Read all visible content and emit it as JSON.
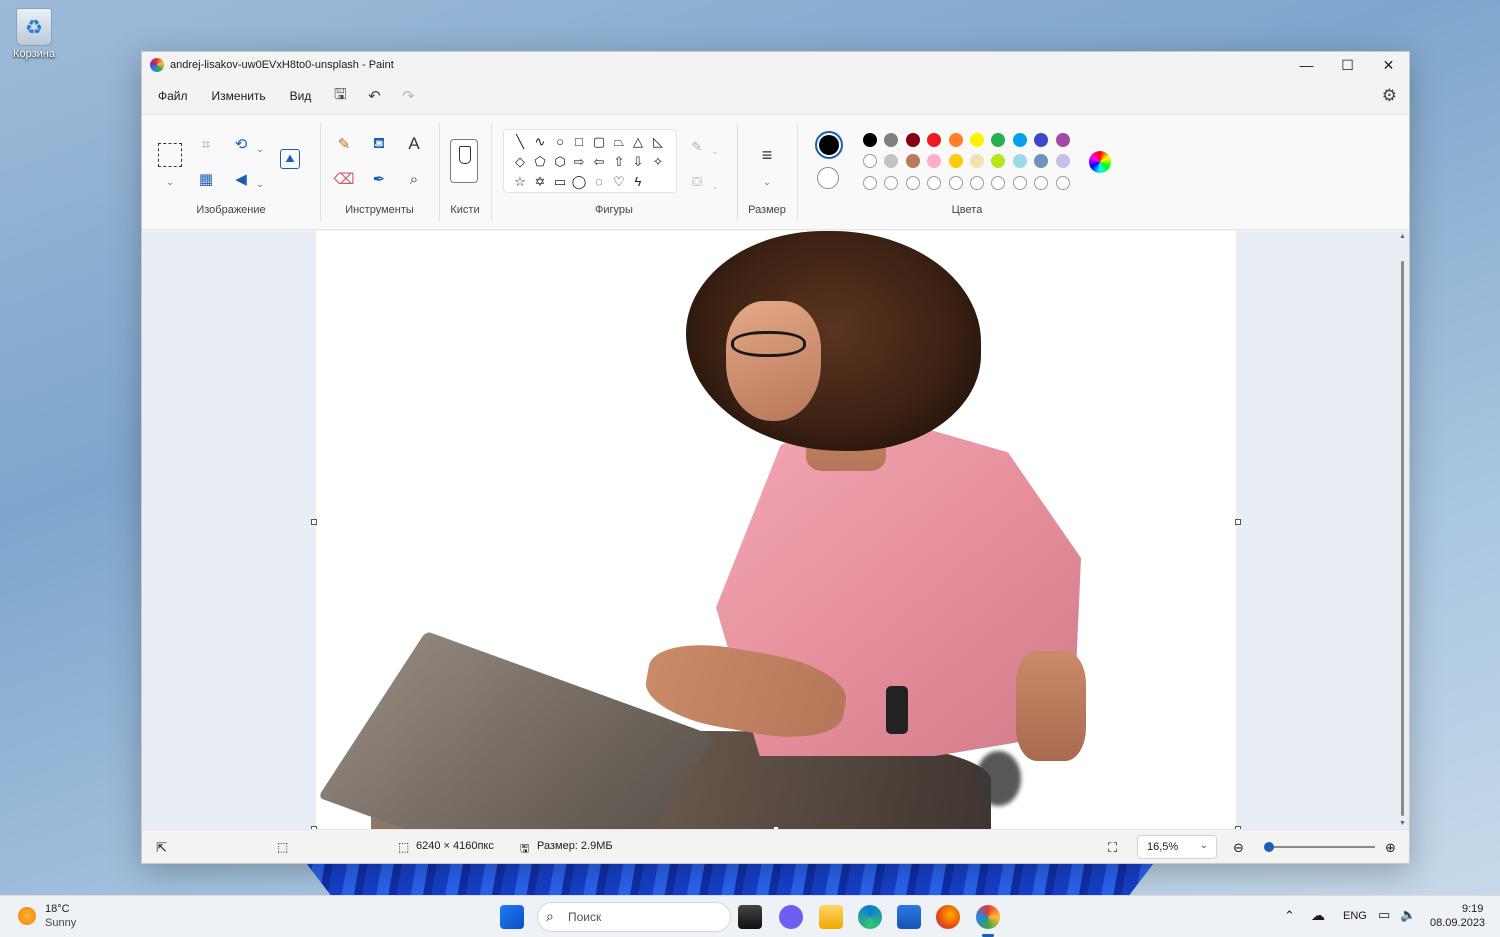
{
  "desktop": {
    "recycle_bin_label": "Корзина"
  },
  "window": {
    "title": "andrej-lisakov-uw0EVxH8to0-unsplash - Paint",
    "controls": {
      "minimize": "—",
      "maximize": "☐",
      "close": "✕"
    }
  },
  "menu": {
    "file": "Файл",
    "edit": "Изменить",
    "view": "Вид"
  },
  "ribbon": {
    "groups": {
      "image": "Изображение",
      "tools": "Инструменты",
      "brushes": "Кисти",
      "shapes": "Фигуры",
      "size": "Размер",
      "colors": "Цвета"
    },
    "palette_row1": [
      "#000000",
      "#7f7f7f",
      "#880015",
      "#ed1c24",
      "#ff7f27",
      "#fff200",
      "#22b14c",
      "#00a2e8",
      "#3f48cc",
      "#a349a4"
    ],
    "palette_row2": [
      "#ffffff",
      "#c3c3c3",
      "#b97a57",
      "#ffaec9",
      "#ffc90e",
      "#efe4b0",
      "#b5e61d",
      "#99d9ea",
      "#7092be",
      "#c8bfe7"
    ],
    "primary_color": "#000000",
    "secondary_color": "#ffffff"
  },
  "status": {
    "dimensions": "6240 × 4160пкс",
    "file_size": "Размер: 2.9МБ",
    "zoom": "16,5%",
    "zoom_level_fraction": 0.0
  },
  "taskbar": {
    "weather_temp": "18°C",
    "weather_desc": "Sunny",
    "search_placeholder": "Поиск",
    "language": "ENG",
    "time": "9:19",
    "date": "08.09.2023"
  }
}
